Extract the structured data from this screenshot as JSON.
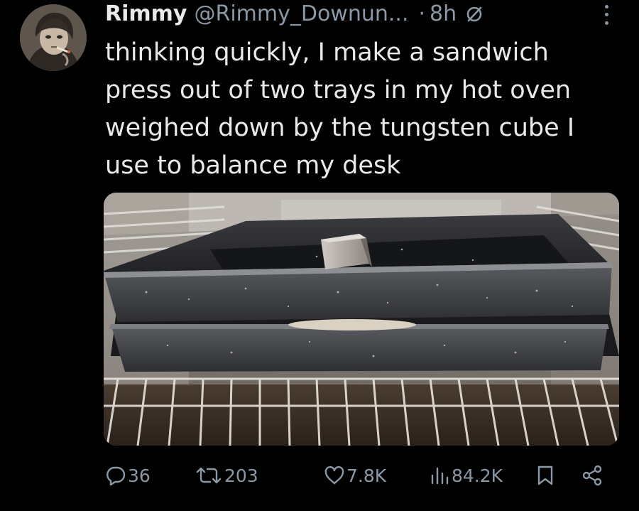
{
  "author": {
    "display_name": "Rimmy",
    "handle": "@Rimmy_Downun...",
    "separator": "·",
    "time": "8h",
    "avatar_icon": "avatar-image",
    "muted_icon": "muted-icon",
    "more_icon": "more-options-icon"
  },
  "tweet": {
    "text_lines": [
      "thinking quickly, I make a sandwich",
      "press out of two trays in my hot oven",
      "weighed down by the tungsten cube I",
      "use to balance my desk"
    ]
  },
  "media": {
    "type": "photo",
    "icon": "oven-photo"
  },
  "actions": {
    "reply": {
      "icon": "reply-icon",
      "count": "36"
    },
    "retweet": {
      "icon": "retweet-icon",
      "count": "203"
    },
    "like": {
      "icon": "like-icon",
      "count": "7.8K"
    },
    "views": {
      "icon": "views-icon",
      "count": "84.2K"
    },
    "bookmark": {
      "icon": "bookmark-icon"
    },
    "share": {
      "icon": "share-icon"
    }
  },
  "colors": {
    "background": "#000000",
    "text_primary": "#e7e9ea",
    "text_secondary": "#8b98a5"
  }
}
